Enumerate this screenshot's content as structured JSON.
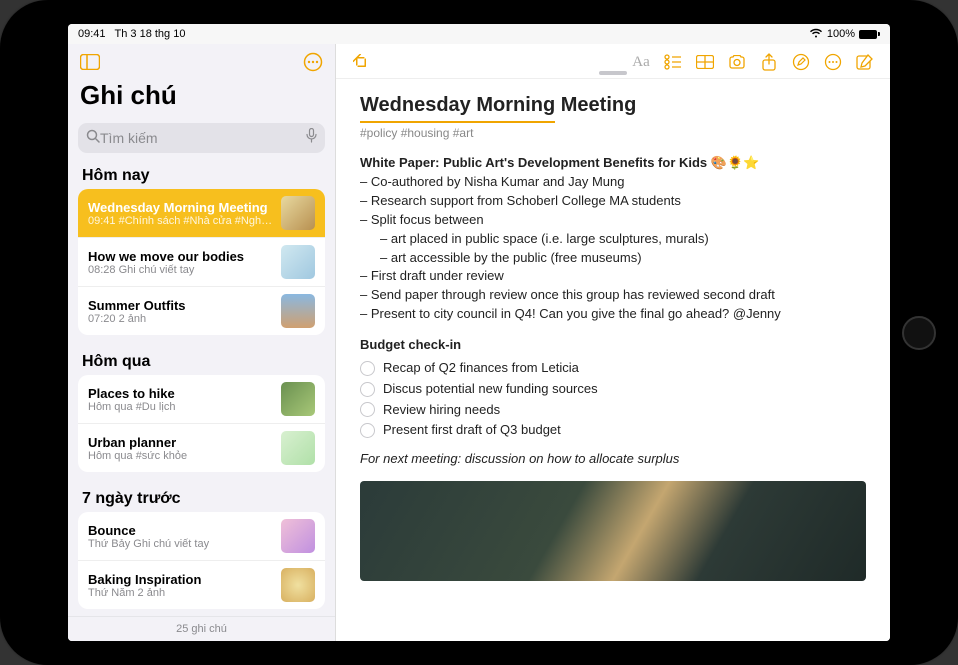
{
  "status": {
    "time": "09:41",
    "date": "Th 3 18 thg 10",
    "battery": "100%"
  },
  "sidebar": {
    "title": "Ghi chú",
    "search_placeholder": "Tìm kiếm",
    "footer": "25 ghi chú",
    "sections": [
      {
        "header": "Hôm nay",
        "items": [
          {
            "title": "Wednesday Morning Meeting",
            "sub": "09:41  #Chính sách #Nhà cửa #Nghệ...",
            "selected": true,
            "thumb": "linear-gradient(135deg,#e8d9a0,#b89050)"
          },
          {
            "title": "How we move our bodies",
            "sub": "08:28  Ghi chú viết tay",
            "thumb": "linear-gradient(135deg,#d0e8f0,#a0c8e0)"
          },
          {
            "title": "Summer Outfits",
            "sub": "07:20  2 ảnh",
            "thumb": "linear-gradient(180deg,#8ab8e0,#d0a070)"
          }
        ]
      },
      {
        "header": "Hôm qua",
        "items": [
          {
            "title": "Places to hike",
            "sub": "Hôm qua  #Du lịch",
            "thumb": "linear-gradient(135deg,#6a9050,#a8c878)"
          },
          {
            "title": "Urban planner",
            "sub": "Hôm qua  #sức khỏe",
            "thumb": "linear-gradient(135deg,#d8f0d0,#b0e0a8)"
          }
        ]
      },
      {
        "header": "7 ngày trước",
        "items": [
          {
            "title": "Bounce",
            "sub": "Thứ Bảy  Ghi chú viết tay",
            "thumb": "linear-gradient(135deg,#f0c0d8,#c090e0)"
          },
          {
            "title": "Baking Inspiration",
            "sub": "Thứ Năm  2 ảnh",
            "thumb": "radial-gradient(circle,#f0e0a0,#d8b060)"
          }
        ]
      }
    ]
  },
  "note": {
    "title_part1": "Wednesday Morning",
    "title_part2": " Meeting",
    "hashtags": "#policy #housing #art",
    "whitepaper_label": "White Paper: Public Art's Development Benefits for Kids",
    "whitepaper_emoji": "🎨🌻⭐",
    "lines": [
      "– Co-authored by Nisha Kumar and Jay Mung",
      "– Research support from Schoberl College MA students",
      "– Split focus between"
    ],
    "indented": [
      "– art placed in public space (i.e. large sculptures, murals)",
      "– art accessible by the public (free museums)"
    ],
    "lines2": [
      "– First draft under review",
      "– Send paper through review once this group has reviewed second draft",
      "– Present to city council in Q4! Can you give the final go ahead? @Jenny"
    ],
    "budget_header": "Budget check-in",
    "checklist": [
      "Recap of Q2 finances from Leticia",
      "Discus potential new funding sources",
      "Review hiring needs",
      "Present first draft of Q3 budget"
    ],
    "next_meeting": "For next meeting: discussion on how to allocate surplus"
  }
}
